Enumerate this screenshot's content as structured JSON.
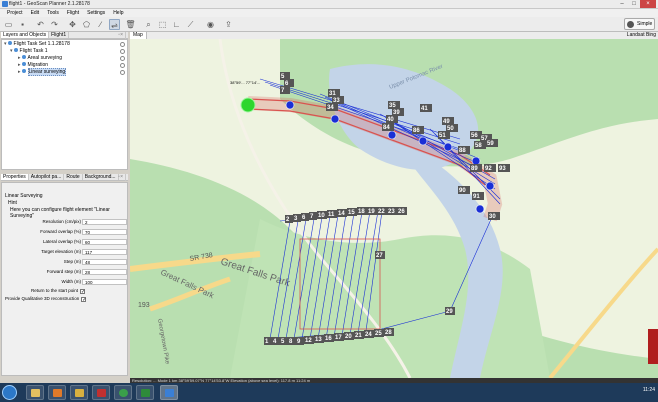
{
  "window": {
    "title": "flight1 - GeoScan Planner 2.1.28178"
  },
  "window_controls": {
    "min": "–",
    "max": "□",
    "close": "×"
  },
  "menu": [
    "Project",
    "Edit",
    "Tools",
    "Flight",
    "Settings",
    "Help"
  ],
  "toolbar": {
    "simple_label": "Simple"
  },
  "layers_panel": {
    "tabs": [
      "Layers and Objects",
      "Flight1"
    ],
    "tree": [
      {
        "label": "Flight Task Set 1.1.28178",
        "level": 0
      },
      {
        "label": "Flight Task 1",
        "level": 1
      },
      {
        "label": "Areal surveying",
        "level": 2
      },
      {
        "label": "Migration",
        "level": 2
      },
      {
        "label": "Linear surveying",
        "level": 2,
        "selected": true
      }
    ]
  },
  "properties_panel": {
    "tabs": [
      "Properties",
      "Autopilot pa...",
      "Route",
      "Background..."
    ],
    "section": "Linear Surveying",
    "hint_title": "Hint",
    "hint_text": "Here you can configure flight element \"Linear Surveying\"",
    "fields": [
      {
        "label": "Resolution (cm/pix)",
        "value": "2"
      },
      {
        "label": "Forward overlap (%)",
        "value": "70"
      },
      {
        "label": "Lateral overlap (%)",
        "value": "60"
      },
      {
        "label": "Target elevation (m)",
        "value": "117"
      },
      {
        "label": "Step (m)",
        "value": "48"
      },
      {
        "label": "Forward step (m)",
        "value": "28"
      },
      {
        "label": "Width (m)",
        "value": "100"
      }
    ],
    "checkboxes": [
      {
        "label": "Return to the start point",
        "checked": true
      },
      {
        "label": "Provide Qualitative 3D reconstruction",
        "checked": true
      }
    ]
  },
  "map": {
    "tab": "Map",
    "layer_labels": [
      "Landsat",
      "Bing"
    ],
    "place_labels": [
      "Great Falls Park",
      "Great Falls Park",
      "SR 738",
      "193",
      "Upper Potomac River",
      "Georgetown Pike"
    ],
    "top_markers": [
      "5",
      "6",
      "7",
      "31",
      "33",
      "34",
      "35",
      "39",
      "40",
      "41",
      "49",
      "50",
      "51",
      "56",
      "57",
      "58",
      "59"
    ],
    "mid_markers": [
      "84",
      "86",
      "88",
      "89",
      "92",
      "93",
      "90",
      "91",
      "30"
    ],
    "row_top": [
      "2",
      "3",
      "6",
      "7",
      "10",
      "11",
      "14",
      "15",
      "18",
      "19",
      "22",
      "23",
      "26"
    ],
    "row_bottom": [
      "1",
      "4",
      "5",
      "8",
      "9",
      "12",
      "13",
      "16",
      "17",
      "20",
      "21",
      "24",
      "25",
      "28"
    ],
    "single_markers": [
      "27",
      "29"
    ]
  },
  "status": {
    "text": "Resolution: ... Mode 1 km    38°59'59.07\"N 77°14'53.8\"W    Elevation (above sea level): 117.8 m    11:24 m"
  },
  "taskbar": {
    "clock": "11:24"
  },
  "colors": {
    "water": "#c3d4e8",
    "land": "#eef3e0",
    "park": "#b9dfb0",
    "corridor": "#d9534f",
    "waypoint": "#1a2fd6",
    "start": "#2ed62e"
  }
}
